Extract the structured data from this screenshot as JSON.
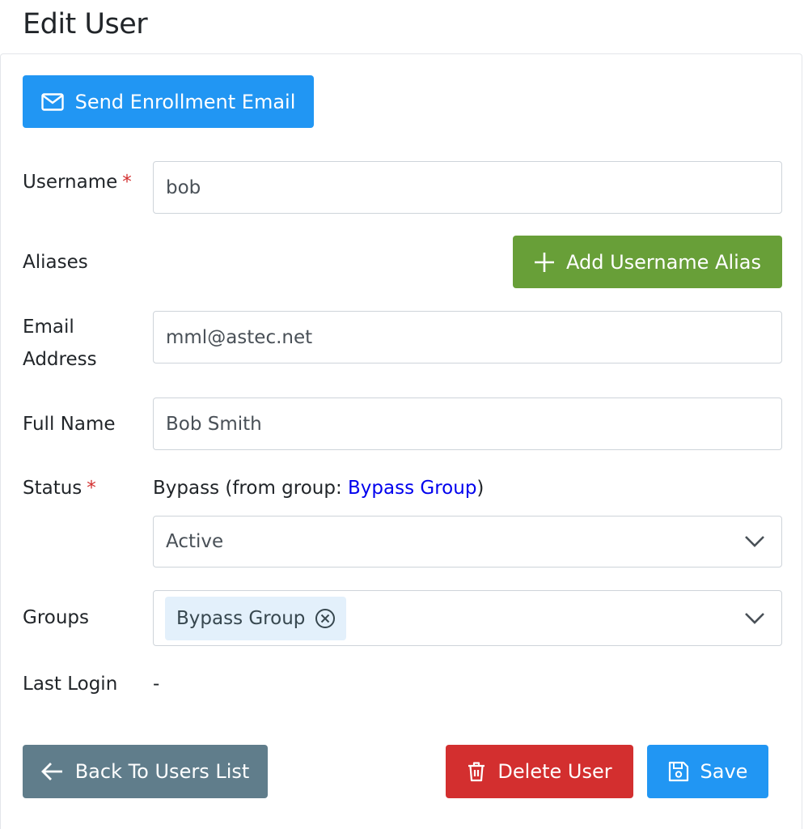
{
  "page": {
    "title": "Edit User"
  },
  "actions": {
    "send_enrollment": "Send Enrollment Email",
    "add_alias": "Add Username Alias",
    "back": "Back To Users List",
    "delete": "Delete User",
    "save": "Save"
  },
  "form": {
    "username": {
      "label": "Username",
      "required_mark": "*",
      "value": "bob"
    },
    "aliases": {
      "label": "Aliases"
    },
    "email": {
      "label_line1": "Email",
      "label_line2": "Address",
      "value": "mml@astec.net"
    },
    "full_name": {
      "label": "Full Name",
      "value": "Bob Smith"
    },
    "status": {
      "label": "Status",
      "required_mark": "*",
      "effective_prefix": "Bypass (from group: ",
      "effective_group_link": "Bypass Group",
      "effective_suffix": ")",
      "selected": "Active"
    },
    "groups": {
      "label": "Groups",
      "chips": [
        "Bypass Group"
      ]
    },
    "last_login": {
      "label": "Last Login",
      "value": "-"
    }
  },
  "colors": {
    "primary": "#2196f3",
    "success": "#689f38",
    "danger": "#d32f2f",
    "secondary": "#607d8b",
    "required": "#d32f2f",
    "link": "#0000ee"
  },
  "icons": {
    "send_enrollment": "envelope-icon",
    "add_alias": "plus-icon",
    "back": "arrow-left-icon",
    "delete": "trash-icon",
    "save": "floppy-disk-icon",
    "dropdown": "chevron-down-icon",
    "chip_remove": "close-circle-icon"
  }
}
